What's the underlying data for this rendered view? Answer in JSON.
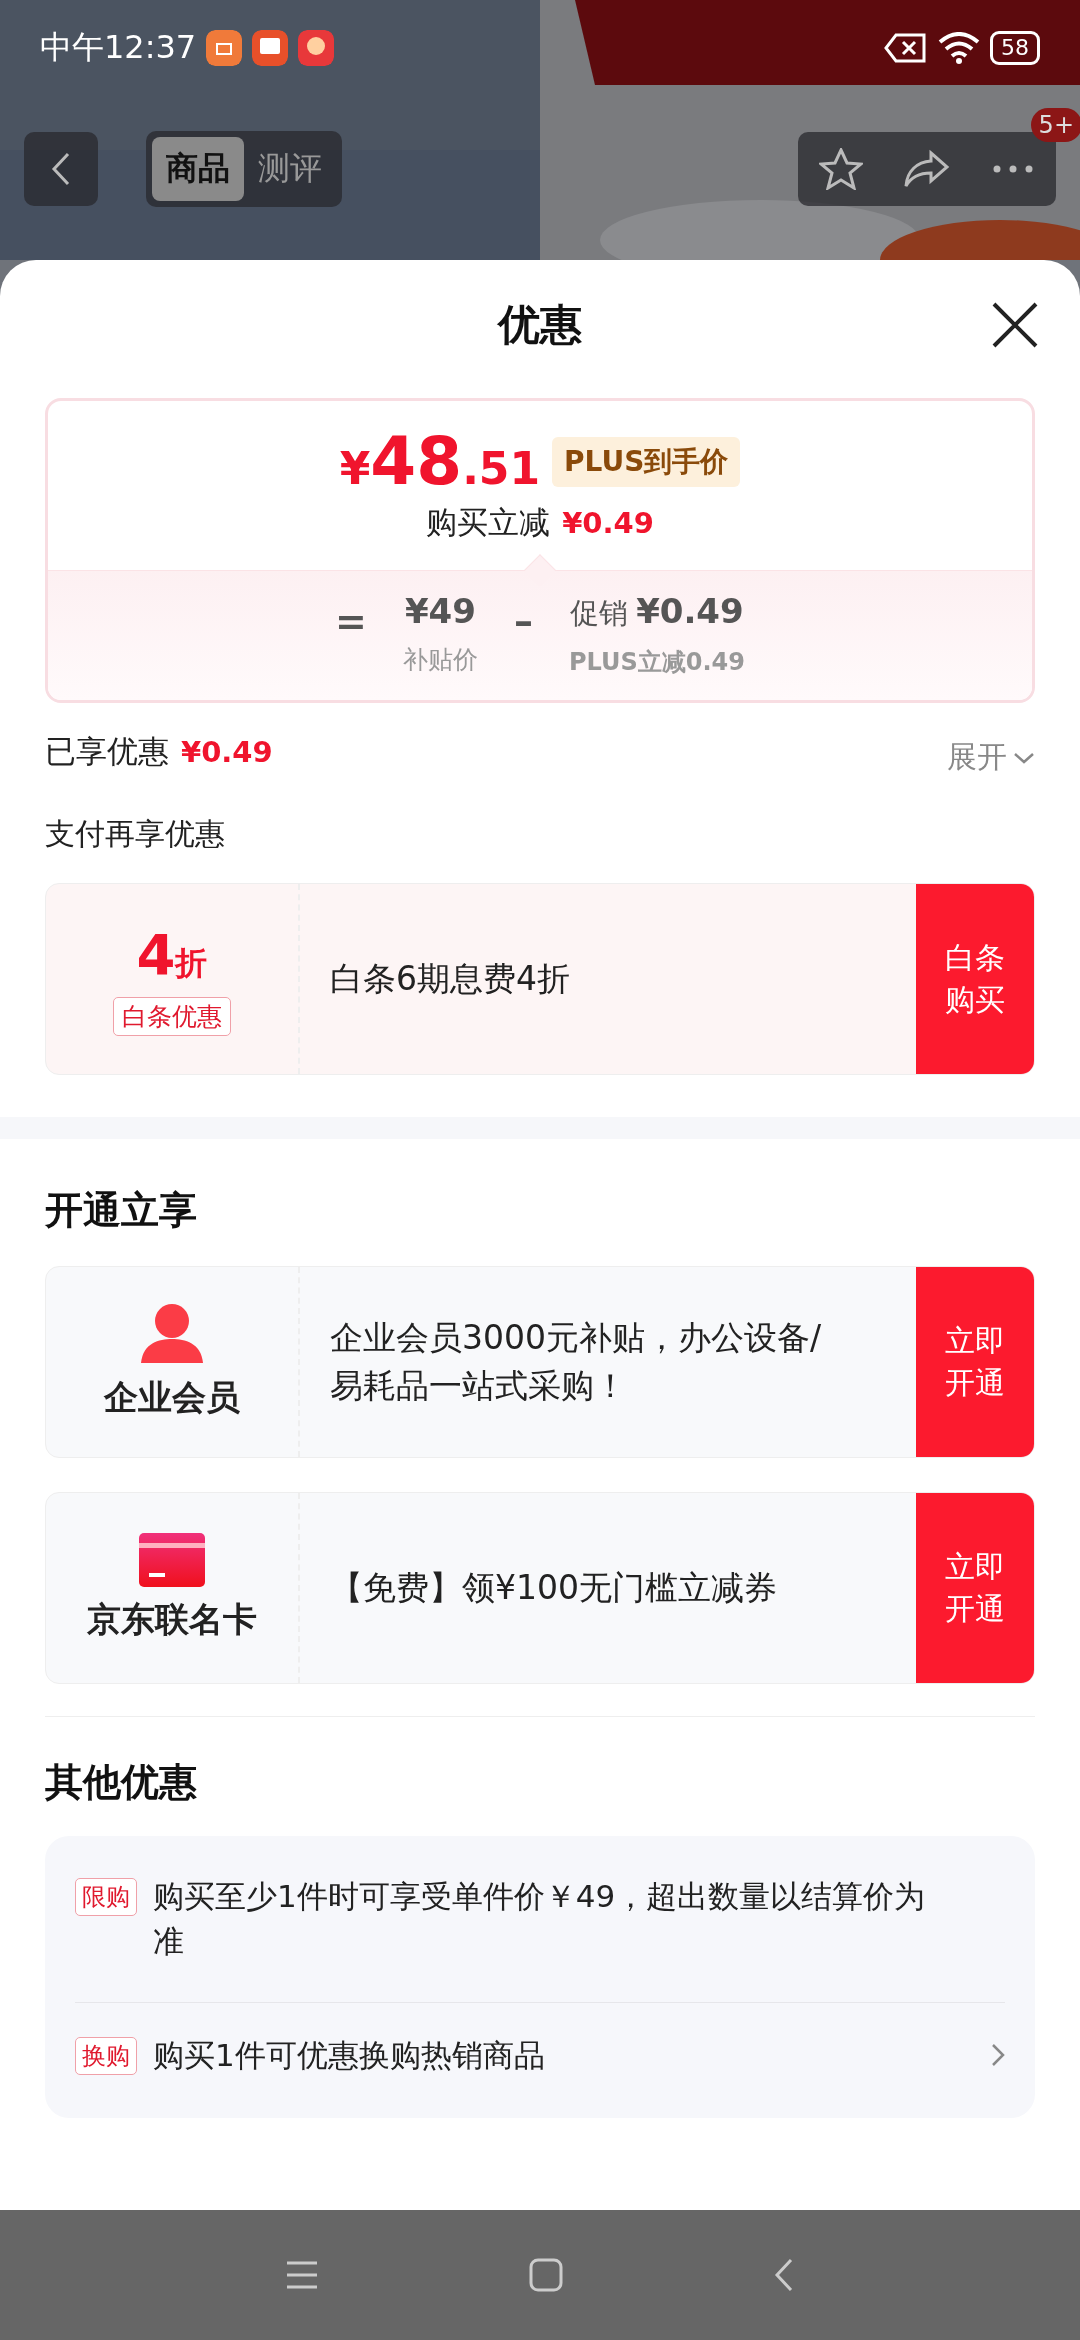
{
  "status_bar": {
    "time": "中午12:37",
    "battery": "58"
  },
  "top_nav": {
    "tabs": [
      {
        "label": "商品",
        "selected": true
      },
      {
        "label": "测评",
        "selected": false
      }
    ],
    "badge": "5+"
  },
  "sheet": {
    "title": "优惠"
  },
  "price_card": {
    "price_symbol": "¥",
    "price_integer": "48",
    "price_decimal": ".51",
    "price_tag": "PLUS到手价",
    "reduction_label": "购买立减",
    "reduction_amount": "¥0.49",
    "equals": "=",
    "base_price": "¥49",
    "base_label": "补贴价",
    "minus": "–",
    "promo_label": "促销",
    "promo_amount": "¥0.49",
    "promo_detail": "PLUS立减0.49"
  },
  "enjoyed": {
    "label": "已享优惠",
    "amount": "¥0.49",
    "expand": "展开"
  },
  "pay_section": {
    "title": "支付再享优惠",
    "offers": [
      {
        "kind": "discount",
        "big": "4",
        "unit": "折",
        "tag": "白条优惠",
        "text": "白条6期息费4折",
        "button": "白条购买"
      }
    ]
  },
  "open_section": {
    "title": "开通立享",
    "offers": [
      {
        "kind": "member",
        "name": "企业会员",
        "text": " 企业会员3000元补贴，办公设备/易耗品一站式采购！",
        "button": "立即开通"
      },
      {
        "kind": "card",
        "name": "京东联名卡",
        "text": "【免费】领¥100无门槛立减券",
        "button": "立即开通"
      }
    ]
  },
  "other_section": {
    "title": "其他优惠",
    "items": [
      {
        "tag": "限购",
        "text": "购买至少1件时可享受单件价￥49，超出数量以结算价为准",
        "has_arrow": false
      },
      {
        "tag": "换购",
        "text": "购买1件可优惠换购热销商品",
        "has_arrow": true
      }
    ]
  }
}
